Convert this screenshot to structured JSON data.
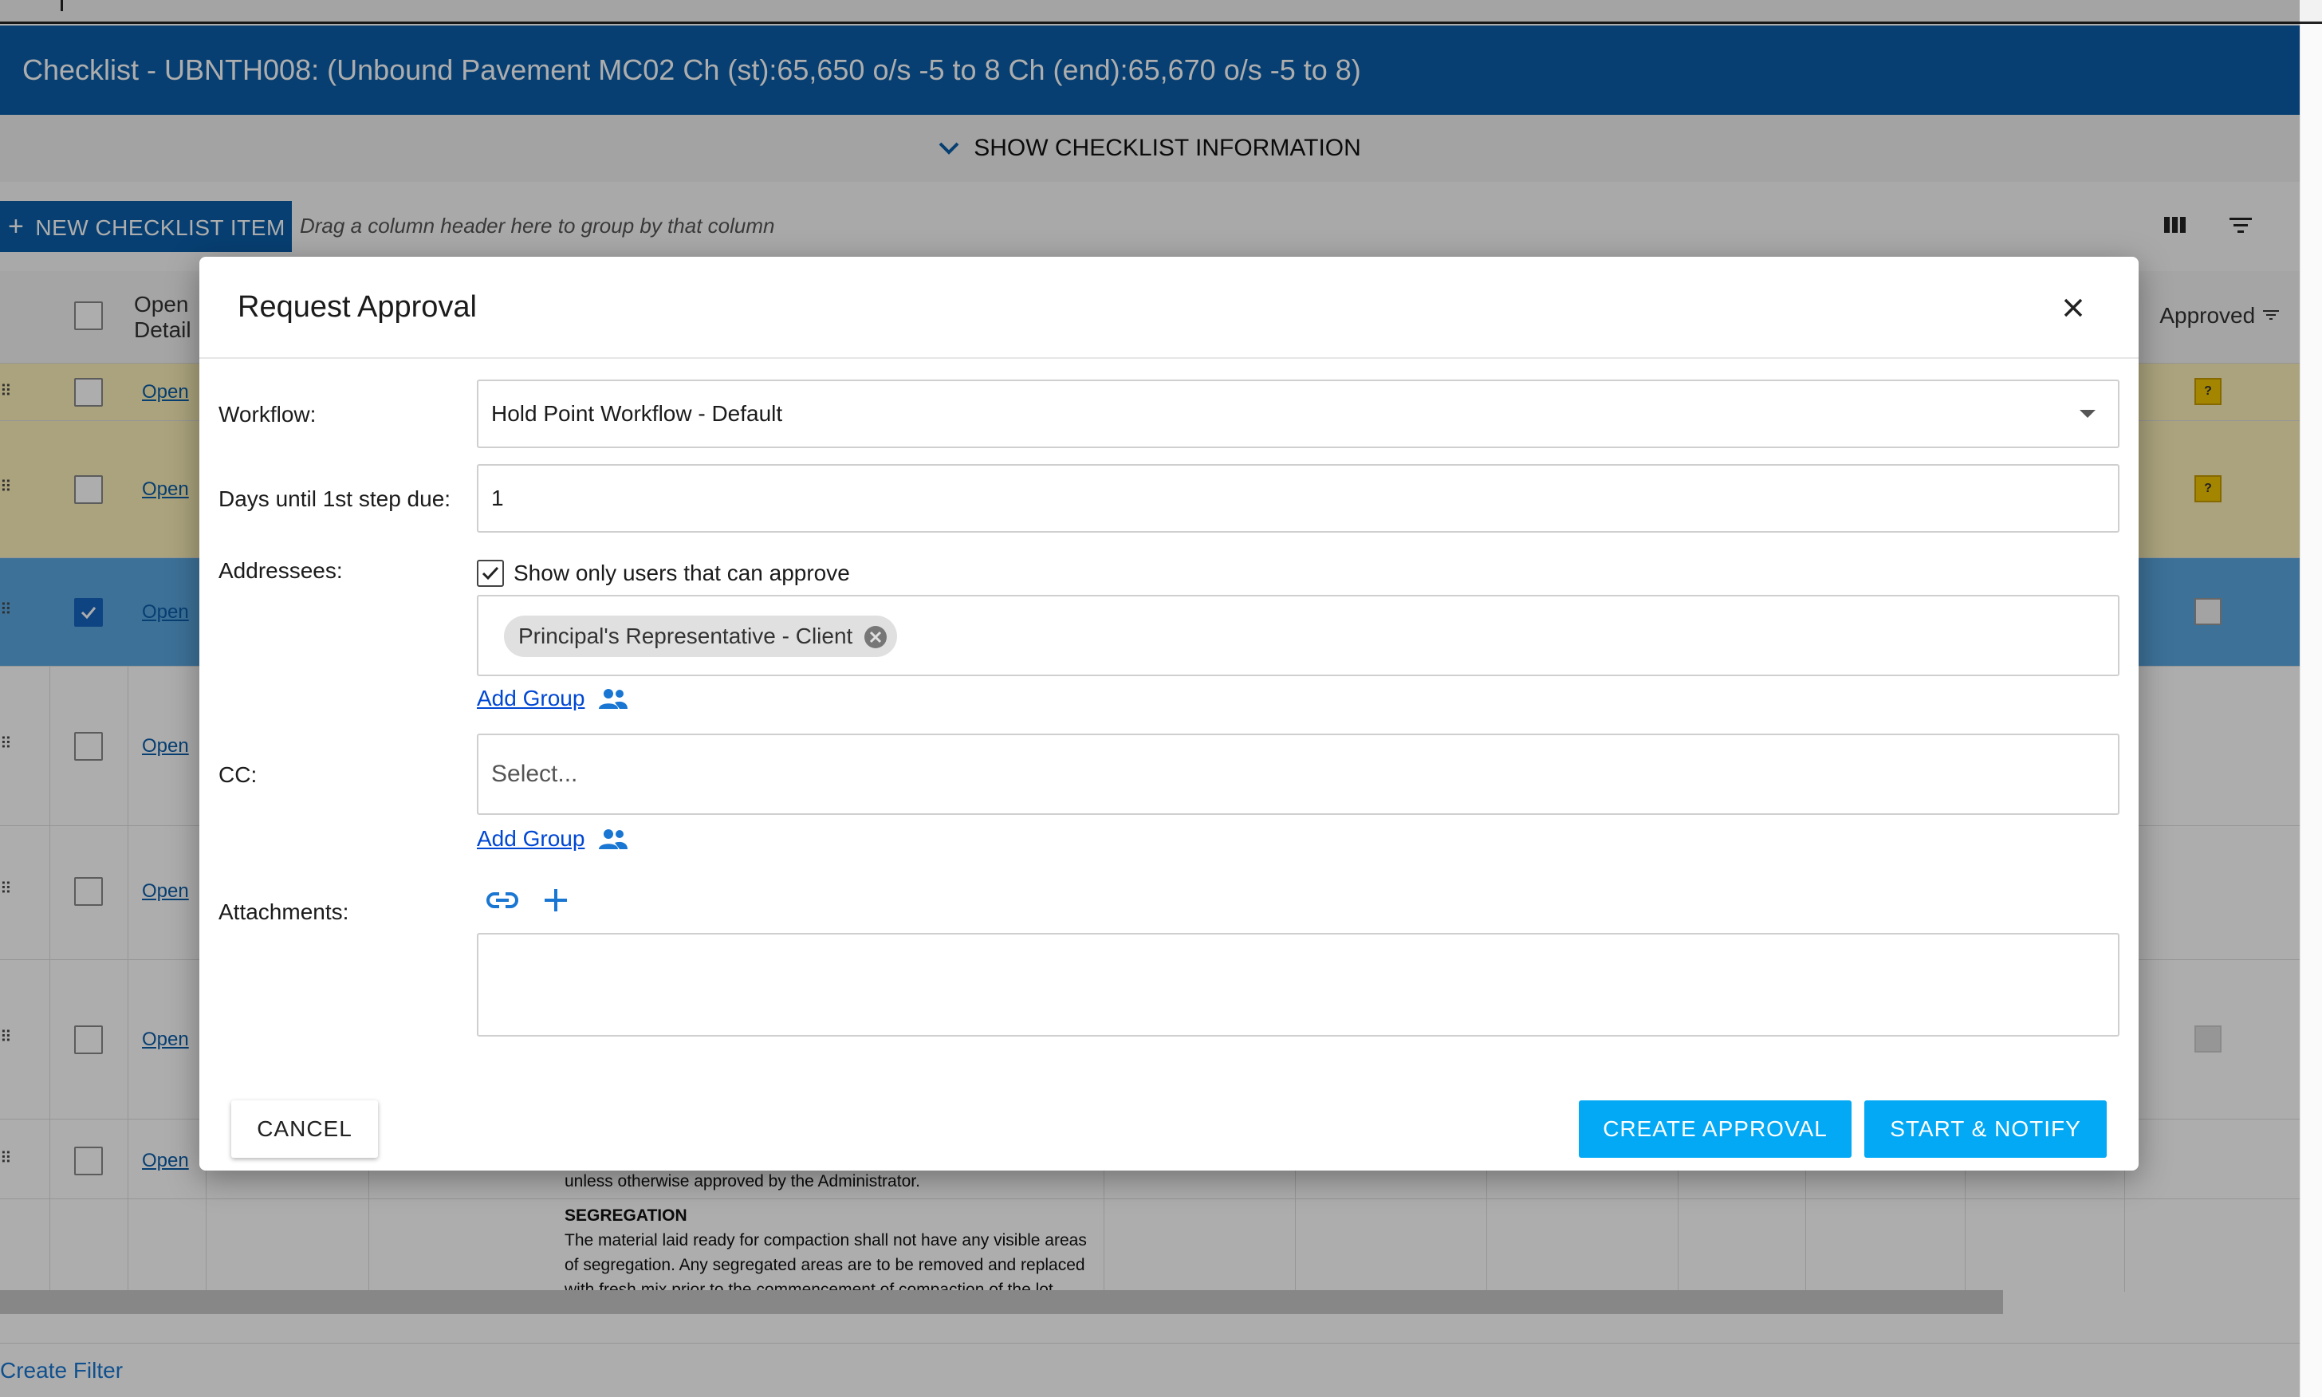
{
  "app": {
    "title": "Checklist - UBNTH008: (Unbound Pavement MC02 Ch (st):65,650 o/s -5 to 8 Ch (end):65,670 o/s -5 to 8)",
    "show_info_label": "SHOW CHECKLIST INFORMATION",
    "new_item_label": "NEW CHECKLIST ITEM",
    "group_hint": "Drag a column header here to group by that column",
    "columns": {
      "open_detail_line1": "Open",
      "open_detail_line2": "Detail",
      "approved": "Approved"
    },
    "open_link": "Open",
    "grid_text": {
      "line1": "unless otherwise approved by the Administrator.",
      "heading": "SEGREGATION",
      "line2": "The material laid ready for compaction shall not have any visible areas",
      "line3": "of segregation. Any segregated areas are to be removed and replaced",
      "line4": "with fresh mix prior to the commencement of compaction of the lot."
    },
    "approved_marker": "?",
    "create_filter": "Create Filter"
  },
  "modal": {
    "title": "Request Approval",
    "workflow": {
      "label": "Workflow:",
      "value": "Hold Point Workflow - Default"
    },
    "days": {
      "label": "Days until 1st step due:",
      "value": "1"
    },
    "addressees": {
      "label": "Addressees:",
      "show_only_label": "Show only users that can approve",
      "show_only_checked": true,
      "chips": [
        "Principal's Representative - Client"
      ],
      "add_group": "Add Group"
    },
    "cc": {
      "label": "CC:",
      "placeholder": "Select...",
      "add_group": "Add Group"
    },
    "attachments": {
      "label": "Attachments:"
    },
    "buttons": {
      "cancel": "CANCEL",
      "create": "CREATE APPROVAL",
      "start": "START & NOTIFY"
    }
  },
  "colors": {
    "brand_blue": "#0b5ea8",
    "accent_button": "#03a9f4",
    "link": "#0047d3",
    "selected_row": "#5aa7e0",
    "pending_row": "#fdf0b8"
  }
}
